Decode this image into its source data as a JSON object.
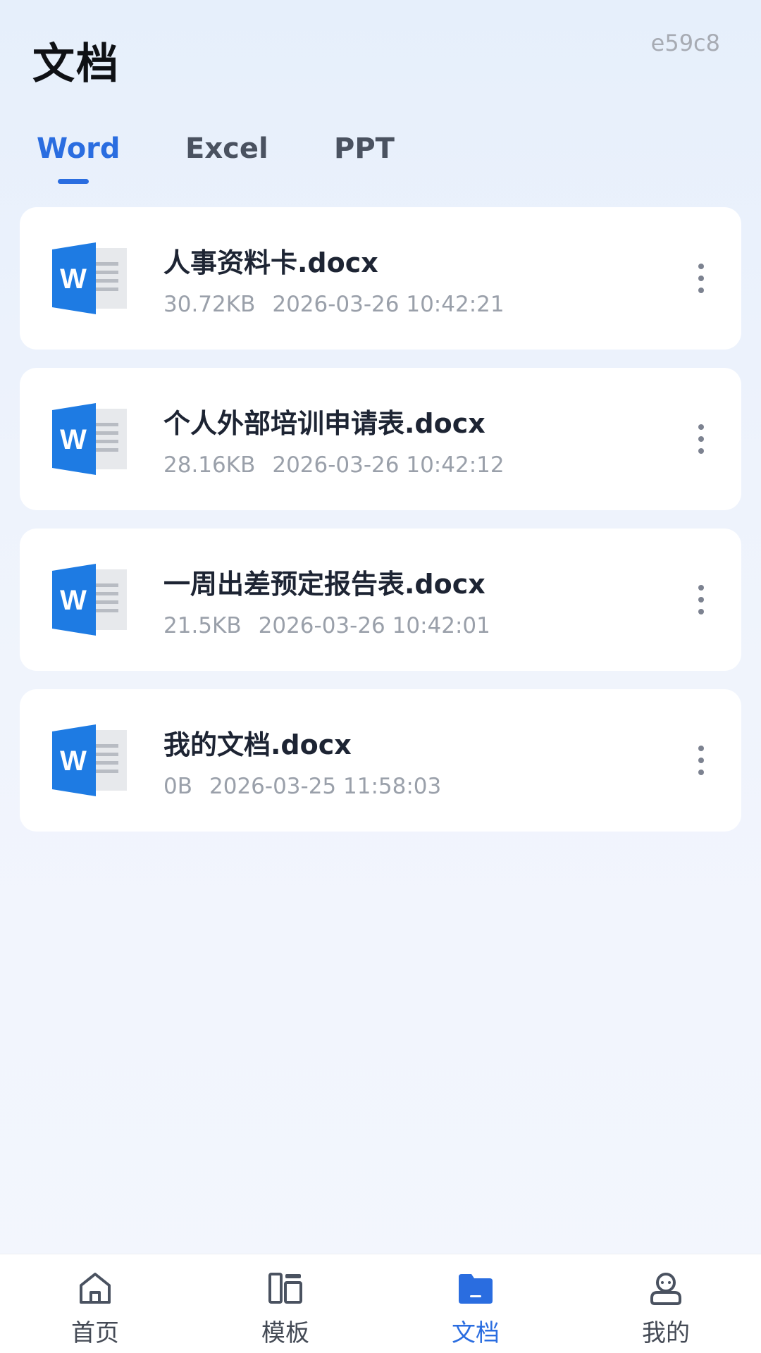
{
  "header": {
    "title": "文档",
    "device_id": "e59c8"
  },
  "tabs": [
    {
      "label": "Word",
      "active": true
    },
    {
      "label": "Excel",
      "active": false
    },
    {
      "label": "PPT",
      "active": false
    }
  ],
  "documents": [
    {
      "name": "人事资料卡.docx",
      "size": "30.72KB",
      "modified": "2026-03-26 10:42:21",
      "icon": "word-doc-icon"
    },
    {
      "name": "个人外部培训申请表.docx",
      "size": "28.16KB",
      "modified": "2026-03-26 10:42:12",
      "icon": "word-doc-icon"
    },
    {
      "name": "一周出差预定报告表.docx",
      "size": "21.5KB",
      "modified": "2026-03-26 10:42:01",
      "icon": "word-doc-icon"
    },
    {
      "name": "我的文档.docx",
      "size": "0B",
      "modified": "2026-03-25 11:58:03",
      "icon": "word-doc-icon"
    }
  ],
  "bottom_nav": [
    {
      "label": "首页",
      "icon": "home-icon",
      "active": false
    },
    {
      "label": "模板",
      "icon": "template-icon",
      "active": false
    },
    {
      "label": "文档",
      "icon": "folder-icon",
      "active": true
    },
    {
      "label": "我的",
      "icon": "profile-icon",
      "active": false
    }
  ],
  "colors": {
    "accent": "#2a6de0",
    "word_blue": "#1e7be3"
  }
}
